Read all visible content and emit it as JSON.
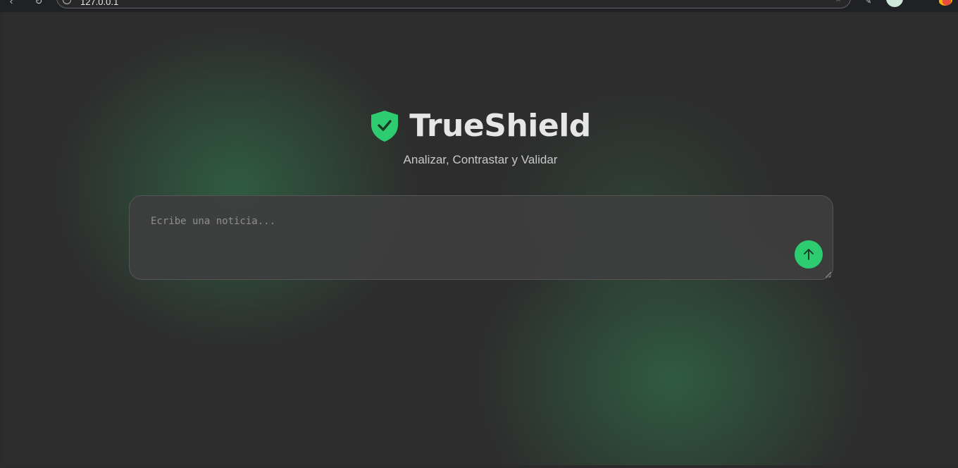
{
  "browser": {
    "url": "127.0.0.1"
  },
  "app": {
    "title": "TrueShield",
    "tagline": "Analizar, Contrastar y Validar"
  },
  "composer": {
    "placeholder": "Ecribe una noticia...",
    "value": ""
  },
  "colors": {
    "accent": "#2ecc71",
    "background": "#2d2d2d",
    "glow": "#32825a"
  },
  "icons": {
    "logo": "shield-check-icon",
    "send": "arrow-up-icon"
  }
}
